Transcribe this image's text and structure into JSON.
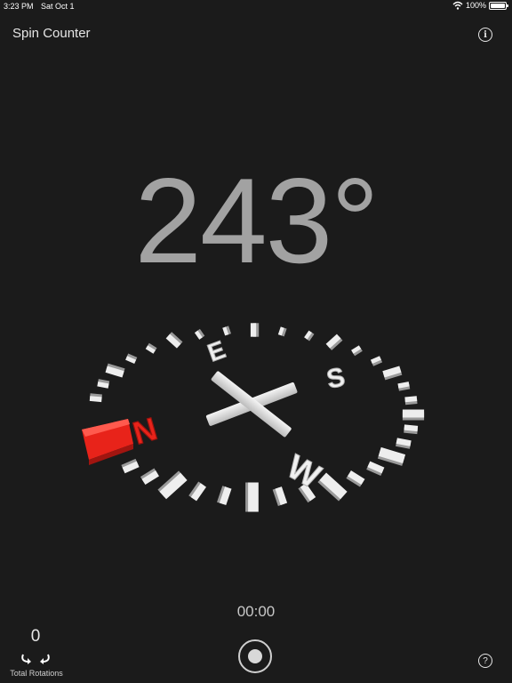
{
  "status_bar": {
    "time": "3:23 PM",
    "date": "Sat Oct 1",
    "battery": "100%"
  },
  "header": {
    "title": "Spin Counter",
    "info_icon": "info-icon",
    "info_glyph": "i"
  },
  "readout": {
    "degrees": "243°"
  },
  "compass": {
    "labels": {
      "north": "N",
      "east": "E",
      "south": "S",
      "west": "W"
    },
    "center_glyph": "X",
    "colors": {
      "ring": "#eeeeee",
      "north": "#e8231a"
    }
  },
  "timer": {
    "elapsed": "00:00"
  },
  "rotations": {
    "count": "0",
    "label": "Total Rotations",
    "icon": "rotate-arrows-icon"
  },
  "controls": {
    "record_icon": "record-icon",
    "help_icon": "help-icon",
    "help_glyph": "?"
  }
}
